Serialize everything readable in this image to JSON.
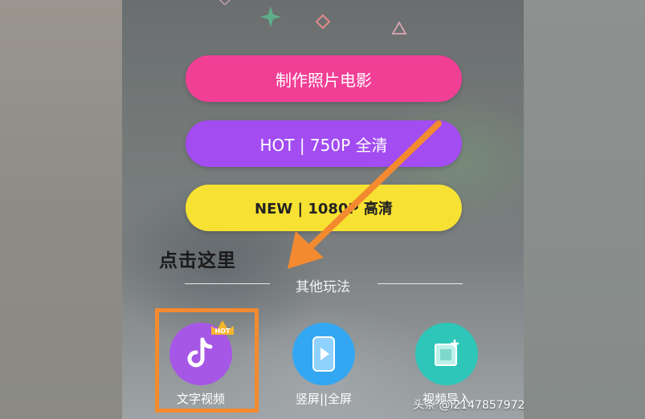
{
  "buttons": {
    "make_photo_movie": "制作照片电影",
    "hot_750p": "HOT | 750P 全清",
    "new_1080p": "NEW | 1080P 高清"
  },
  "annotation": {
    "click_here": "点击这里"
  },
  "section": {
    "title": "其他玩法"
  },
  "features": [
    {
      "label": "文字视频",
      "icon": "tiktok-note-icon",
      "badge": "HOT"
    },
    {
      "label": "竖屏||全屏",
      "icon": "phone-play-icon"
    },
    {
      "label": "视频导入",
      "icon": "video-import-icon"
    }
  ],
  "watermark": "头条 @i2147857972",
  "colors": {
    "pink": "#f23f96",
    "purple": "#a24cf2",
    "yellow": "#f7e132",
    "highlight_orange": "#f38a2f"
  }
}
